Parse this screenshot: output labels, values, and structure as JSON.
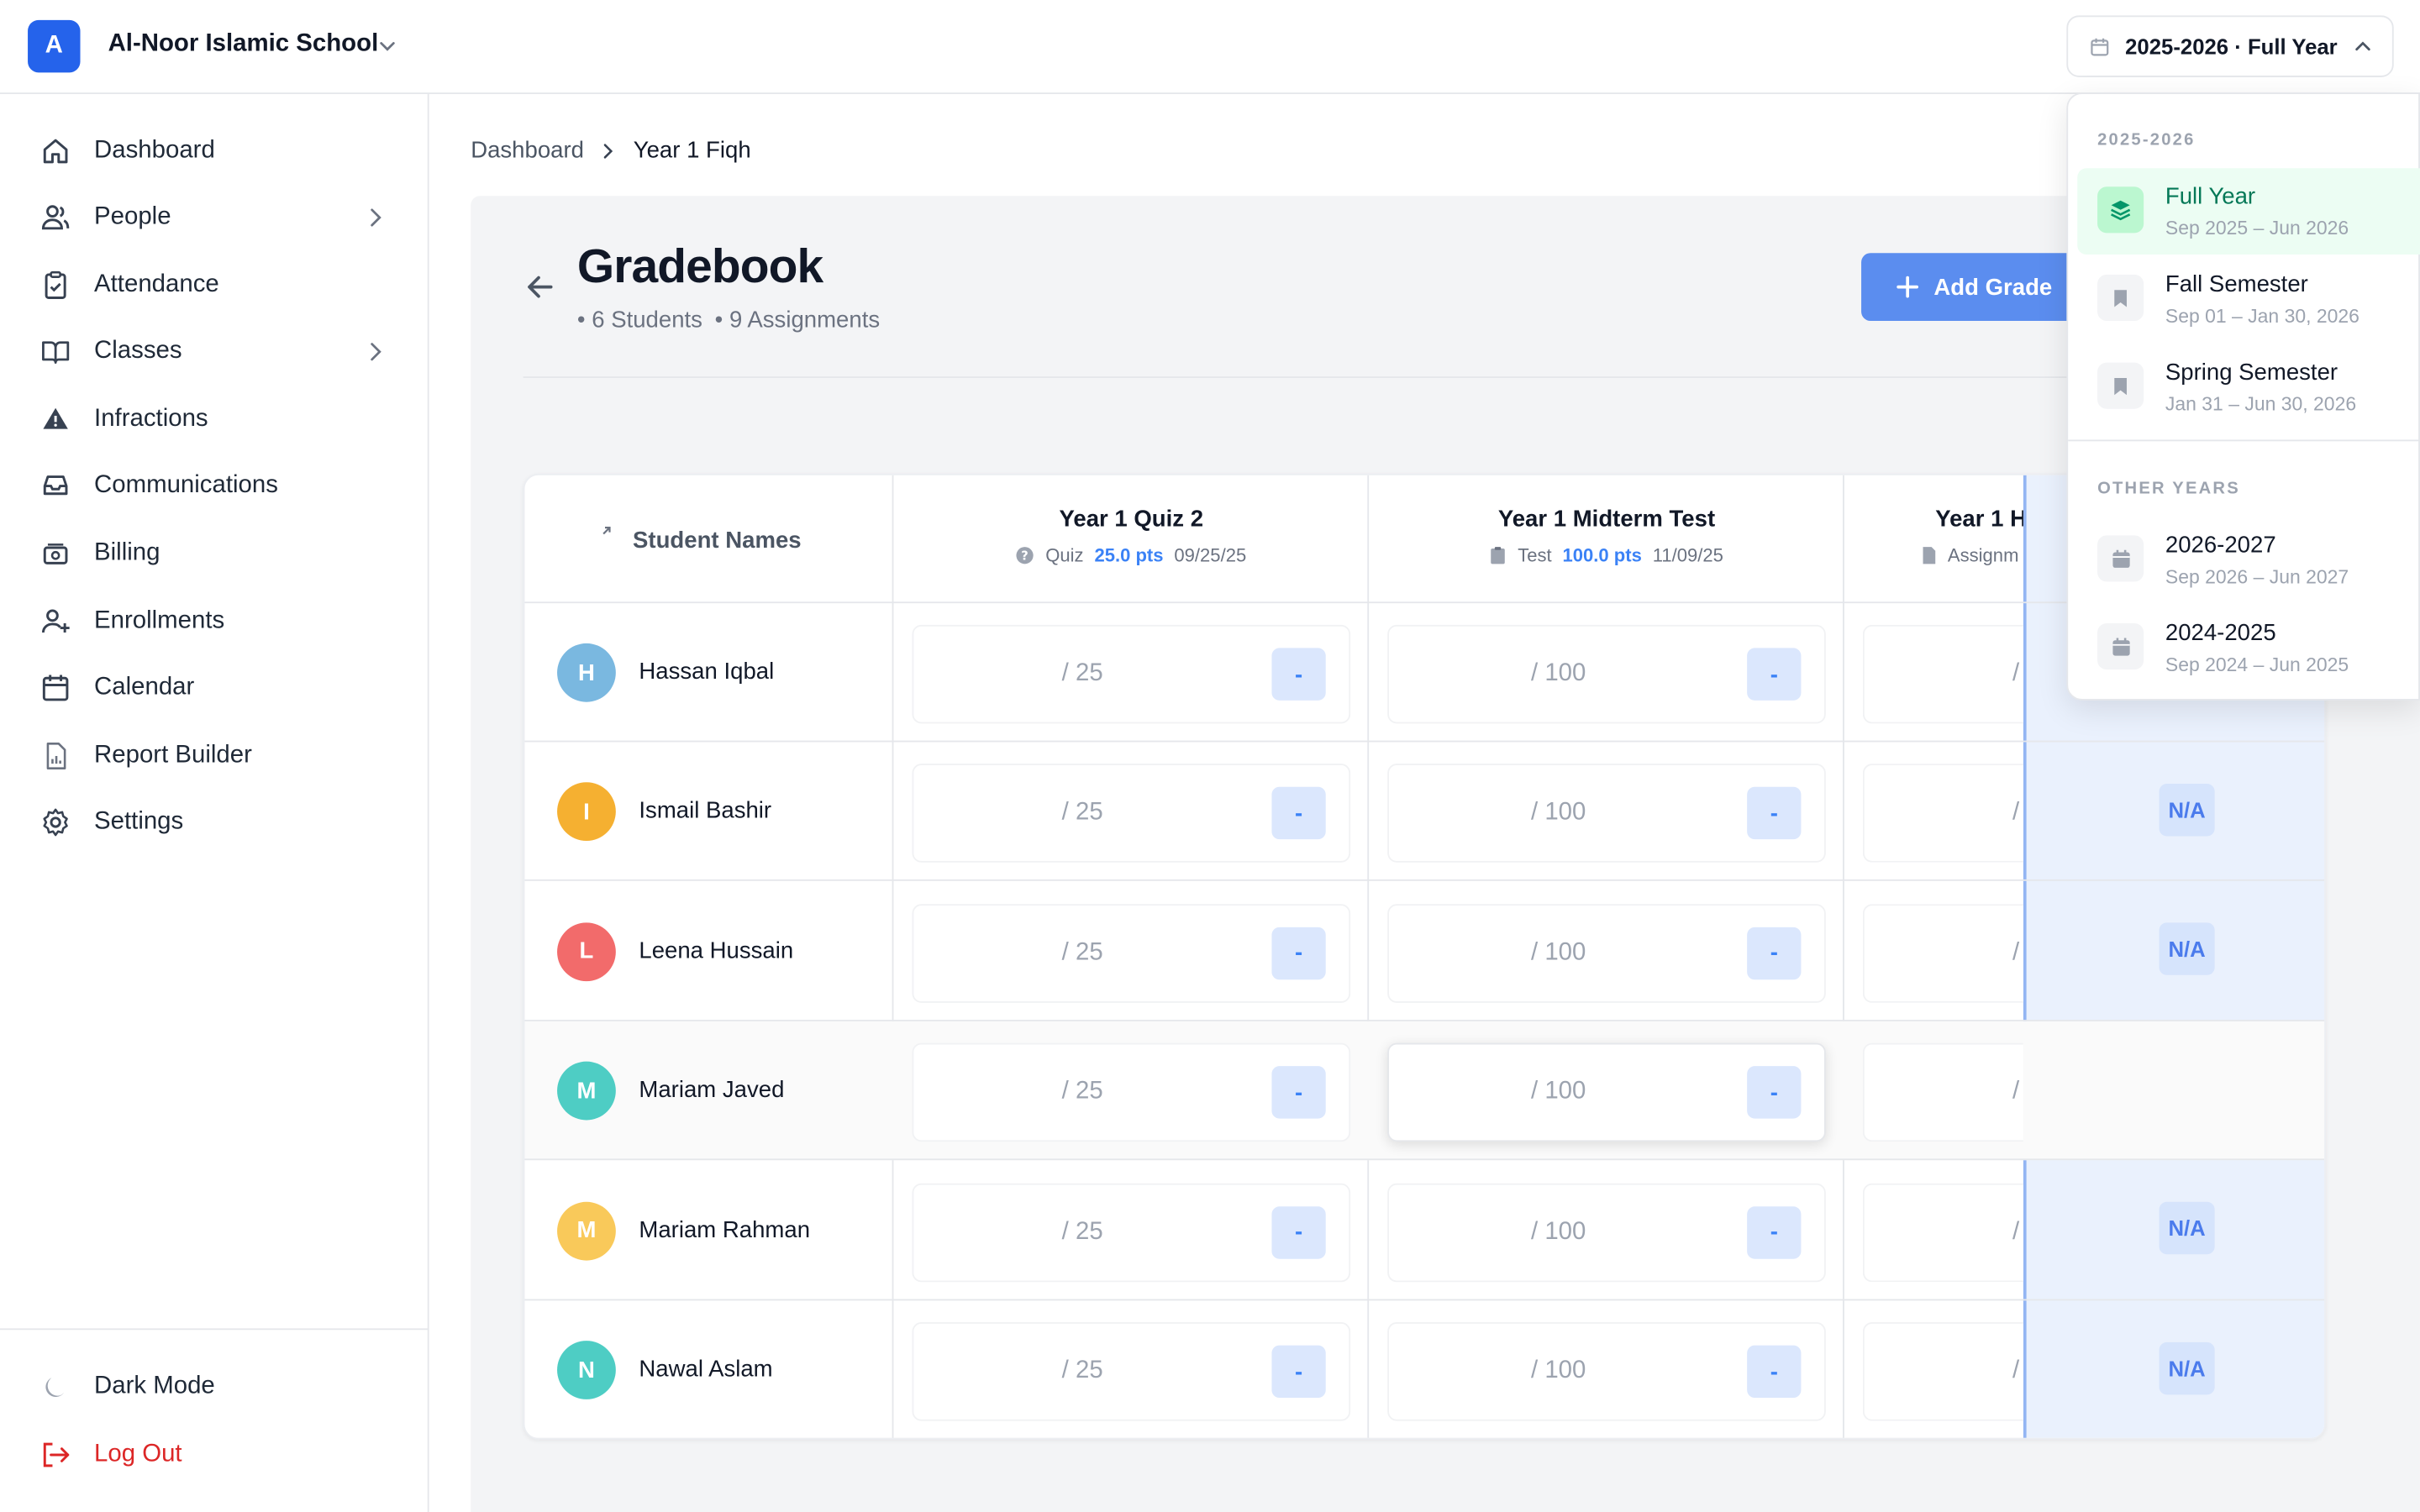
{
  "header": {
    "logo_letter": "A",
    "school_name": "Al-Noor Islamic School",
    "year_selector": "2025-2026 · Full Year"
  },
  "sidebar": {
    "items": [
      {
        "label": "Dashboard",
        "icon": "home-icon"
      },
      {
        "label": "People",
        "icon": "users-icon"
      },
      {
        "label": "Attendance",
        "icon": "clipboard-check-icon"
      },
      {
        "label": "Classes",
        "icon": "book-open-icon"
      },
      {
        "label": "Infractions",
        "icon": "warning-icon"
      },
      {
        "label": "Communications",
        "icon": "inbox-icon"
      },
      {
        "label": "Billing",
        "icon": "billing-icon"
      },
      {
        "label": "Enrollments",
        "icon": "user-plus-icon"
      },
      {
        "label": "Calendar",
        "icon": "calendar-icon"
      },
      {
        "label": "Report Builder",
        "icon": "report-icon"
      },
      {
        "label": "Settings",
        "icon": "gear-icon"
      }
    ],
    "dark_mode": "Dark Mode",
    "logout": "Log Out"
  },
  "breadcrumb": {
    "root": "Dashboard",
    "current": "Year 1 Fiqh"
  },
  "page": {
    "title": "Gradebook",
    "students": "• 6 Students",
    "assignments": "• 9 Assignments",
    "add_button": "Add Grade"
  },
  "table": {
    "names_header": "Student Names",
    "columns": [
      {
        "title": "Year 1 Quiz 2",
        "type": "Quiz",
        "points": "25.0 pts",
        "date": "09/25/25",
        "max": "/ 25"
      },
      {
        "title": "Year 1 Midterm Test",
        "type": "Test",
        "points": "100.0 pts",
        "date": "11/09/25",
        "max": "/ 100"
      },
      {
        "title": "Year 1 H",
        "type": "Assignm",
        "max": "/"
      }
    ],
    "empty_grade": "-",
    "average_value": "N/A",
    "students": [
      {
        "name": "Hassan Iqbal",
        "initial": "H",
        "color": "#7ab8e0"
      },
      {
        "name": "Ismail Bashir",
        "initial": "I",
        "color": "#f5b031"
      },
      {
        "name": "Leena Hussain",
        "initial": "L",
        "color": "#f26b6b"
      },
      {
        "name": "Mariam Javed",
        "initial": "M",
        "color": "#4ecdc4"
      },
      {
        "name": "Mariam Rahman",
        "initial": "M",
        "color": "#f9c95a"
      },
      {
        "name": "Nawal Aslam",
        "initial": "N",
        "color": "#4ecdc4"
      }
    ]
  },
  "dropdown": {
    "current_heading": "2025-2026",
    "current_items": [
      {
        "name": "Full Year",
        "range": "Sep 2025 – Jun 2026"
      },
      {
        "name": "Fall Semester",
        "range": "Sep 01 – Jan 30, 2026"
      },
      {
        "name": "Spring Semester",
        "range": "Jan 31 – Jun 30, 2026"
      }
    ],
    "other_heading": "OTHER YEARS",
    "other_items": [
      {
        "name": "2026-2027",
        "range": "Sep 2026 – Jun 2027"
      },
      {
        "name": "2024-2025",
        "range": "Sep 2024 – Jun 2025"
      }
    ]
  },
  "colors": {
    "accent": "#2563eb",
    "button": "#5b8def",
    "selected": "#047857",
    "danger": "#dc2626"
  }
}
